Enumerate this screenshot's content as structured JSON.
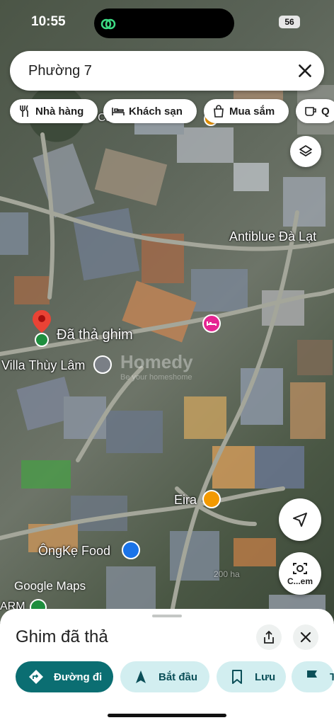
{
  "status_bar": {
    "time": "10:55",
    "battery": "56"
  },
  "search": {
    "query": "Phường 7"
  },
  "chips": [
    "Nhà hàng",
    "Khách sạn",
    "Mua sắm",
    "Q"
  ],
  "map_labels": {
    "antiblue": "Antiblue Đà Lạt",
    "dropped_pin": "Đã thả ghim",
    "villa": "Villa Thùy Lâm",
    "eira": "Eira",
    "ongke": "ÔngKẹ Food",
    "cafe_top": "Cafe Buluehellt",
    "arm": "ARM",
    "watermark": "Homedy",
    "watermark_sub": "Be your homeshome",
    "faint_text": "200 ha"
  },
  "google_logo": "Google Maps",
  "camera_button": {
    "label": "C...em"
  },
  "sheet": {
    "title": "Ghim đã thả"
  },
  "actions": [
    {
      "label": "Đường đi"
    },
    {
      "label": "Bắt đầu"
    },
    {
      "label": "Lưu"
    },
    {
      "label": "T"
    }
  ],
  "colors": {
    "primary": "#0b6e72",
    "secondary": "#d2eef0",
    "pin_red": "#ea4335",
    "pin_green": "#1e8e3e",
    "poi_orange": "#f29900",
    "poi_blue": "#1a73e8",
    "poi_pink": "#e52592"
  },
  "icons": [
    "search-close-icon",
    "utensils-icon",
    "bed-icon",
    "shopping-bag-icon",
    "coffee-icon",
    "layers-icon",
    "navigation-icon",
    "camera-search-icon",
    "share-icon",
    "close-icon",
    "directions-icon",
    "start-arrow-icon",
    "bookmark-icon",
    "flag-icon"
  ]
}
